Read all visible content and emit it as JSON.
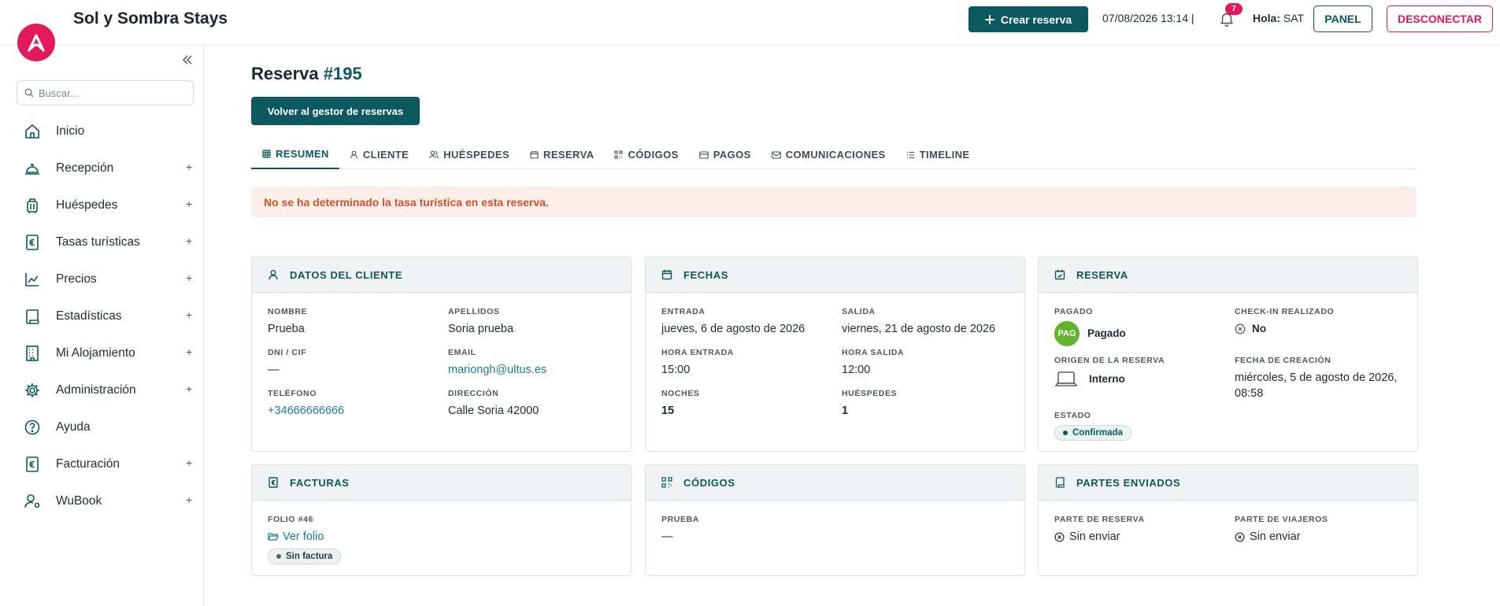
{
  "app": {
    "title": "Sol y Sombra Stays",
    "accent": "#0c5861",
    "brand": "#e2195b"
  },
  "topbar": {
    "create_label": "Crear reserva",
    "datetime": "07/08/2026 13:14 |",
    "notifications_count": "7",
    "greeting_label": "Hola:",
    "user": "SAT",
    "panel_label": "PANEL",
    "logout_label": "DESCONECTAR"
  },
  "sidebar": {
    "search_placeholder": "Buscar...",
    "items": [
      {
        "label": "Inicio",
        "icon": "home-icon",
        "expandable": false
      },
      {
        "label": "Recepción",
        "icon": "reception-bell-icon",
        "expandable": true
      },
      {
        "label": "Huéspedes",
        "icon": "luggage-icon",
        "expandable": true
      },
      {
        "label": "Tasas turísticas",
        "icon": "euro-tax-icon",
        "expandable": true
      },
      {
        "label": "Precios",
        "icon": "chart-line-icon",
        "expandable": true
      },
      {
        "label": "Estadísticas",
        "icon": "scroll-icon",
        "expandable": true
      },
      {
        "label": "Mi Alojamiento",
        "icon": "building-icon",
        "expandable": true
      },
      {
        "label": "Administración",
        "icon": "gear-icon",
        "expandable": true
      },
      {
        "label": "Ayuda",
        "icon": "help-icon",
        "expandable": false
      },
      {
        "label": "Facturación",
        "icon": "invoice-euro-icon",
        "expandable": true
      },
      {
        "label": "WuBook",
        "icon": "user-gear-icon",
        "expandable": true
      }
    ],
    "plus": "+"
  },
  "page": {
    "title_prefix": "Reserva",
    "title_number": "#195",
    "back_label": "Volver al gestor de reservas"
  },
  "tabs": [
    {
      "label": "RESUMEN",
      "icon": "grid-icon",
      "active": true
    },
    {
      "label": "CLIENTE",
      "icon": "user-icon",
      "active": false
    },
    {
      "label": "HUÉSPEDES",
      "icon": "users-icon",
      "active": false
    },
    {
      "label": "RESERVA",
      "icon": "calendar-icon",
      "active": false
    },
    {
      "label": "CÓDIGOS",
      "icon": "qr-icon",
      "active": false
    },
    {
      "label": "PAGOS",
      "icon": "credit-card-icon",
      "active": false
    },
    {
      "label": "COMUNICACIONES",
      "icon": "mail-icon",
      "active": false
    },
    {
      "label": "TIMELINE",
      "icon": "list-icon",
      "active": false
    }
  ],
  "alert": "No se ha determinado la tasa turística en esta reserva.",
  "cards": {
    "cliente": {
      "title": "DATOS DEL CLIENTE",
      "nombre_label": "NOMBRE",
      "nombre": "Prueba",
      "apellidos_label": "APELLIDOS",
      "apellidos": "Soria prueba",
      "dni_label": "DNI / CIF",
      "dni": "—",
      "email_label": "EMAIL",
      "email": "mariongh@ultus.es",
      "telefono_label": "TELÉFONO",
      "telefono": "+34666666666",
      "direccion_label": "DIRECCIÓN",
      "direccion": "Calle Soria 42000"
    },
    "fechas": {
      "title": "FECHAS",
      "entrada_label": "ENTRADA",
      "entrada": "jueves, 6 de agosto de 2026",
      "salida_label": "SALIDA",
      "salida": "viernes, 21 de agosto de 2026",
      "hora_entrada_label": "HORA ENTRADA",
      "hora_entrada": "15:00",
      "hora_salida_label": "HORA SALIDA",
      "hora_salida": "12:00",
      "noches_label": "NOCHES",
      "noches": "15",
      "huespedes_label": "HUÉSPEDES",
      "huespedes": "1"
    },
    "reserva": {
      "title": "RESERVA",
      "pagado_label": "PAGADO",
      "pagado_badge": "PAG",
      "pagado": "Pagado",
      "checkin_label": "CHECK-IN REALIZADO",
      "checkin": "No",
      "origen_label": "ORIGEN DE LA RESERVA",
      "origen": "Interno",
      "creacion_label": "FECHA DE CREACIÓN",
      "creacion": "miércoles, 5 de agosto de 2026, 08:58",
      "estado_label": "ESTADO",
      "estado": "Confirmada"
    },
    "facturas": {
      "title": "FACTURAS",
      "folio_label": "FOLIO #46",
      "ver_folio": "Ver folio",
      "sin_factura": "Sin factura"
    },
    "codigos": {
      "title": "CÓDIGOS",
      "prueba_label": "PRUEBA",
      "prueba": "—"
    },
    "partes": {
      "title": "PARTES ENVIADOS",
      "reserva_label": "PARTE DE RESERVA",
      "reserva": "Sin enviar",
      "viajeros_label": "PARTE DE VIAJEROS",
      "viajeros": "Sin enviar"
    }
  }
}
